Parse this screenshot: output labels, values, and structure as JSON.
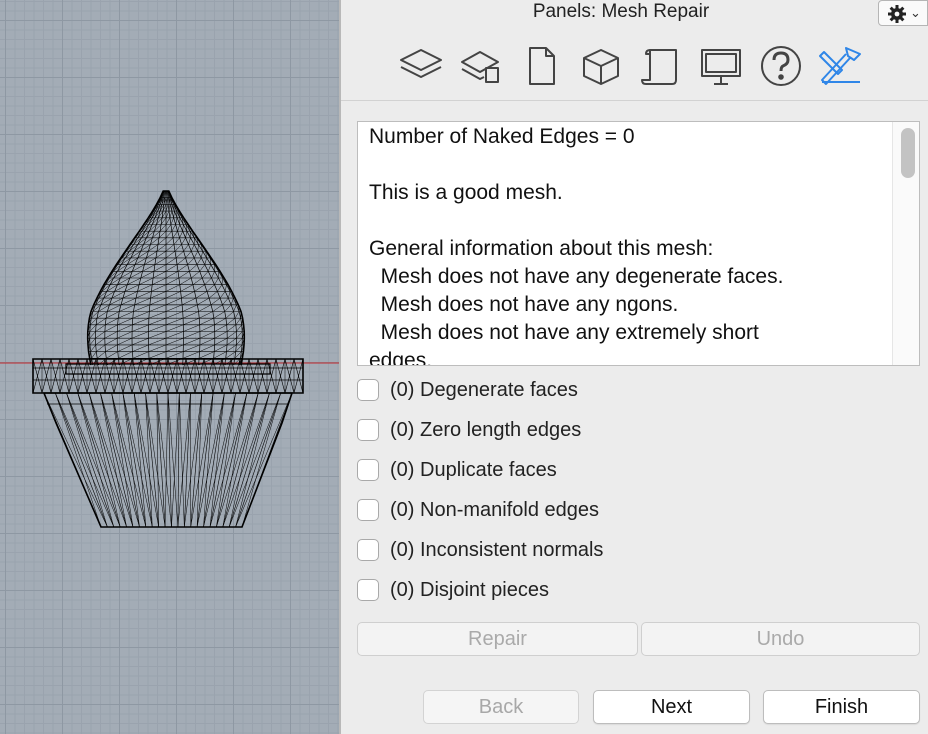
{
  "panel": {
    "title": "Panels: Mesh Repair"
  },
  "toolbar": {
    "icons": [
      "layers-icon",
      "layer-states-icon",
      "document-icon",
      "object-properties-icon",
      "notes-icon",
      "display-icon",
      "help-icon",
      "mesh-repair-icon"
    ],
    "active": "mesh-repair-icon",
    "accent": "#2f86e8"
  },
  "info": {
    "lines": [
      "Number of Naked Edges = 0",
      "",
      "This is a good mesh.",
      "",
      "General information about this mesh:",
      "  Mesh does not have any degenerate faces.",
      "  Mesh does not have any ngons.",
      "  Mesh does not have any extremely short",
      "edges."
    ]
  },
  "checks": [
    "(0) Degenerate faces",
    "(0) Zero length edges",
    "(0) Duplicate faces",
    "(0) Non-manifold edges",
    "(0) Inconsistent normals",
    "(0) Disjoint pieces"
  ],
  "actions": {
    "repair": "Repair",
    "undo": "Undo"
  },
  "nav": {
    "back": "Back",
    "next": "Next",
    "finish": "Finish"
  },
  "viewport": {
    "grid_color": "#8e98a3",
    "background": "#a3acb6",
    "axis_color": "#c0282d"
  }
}
